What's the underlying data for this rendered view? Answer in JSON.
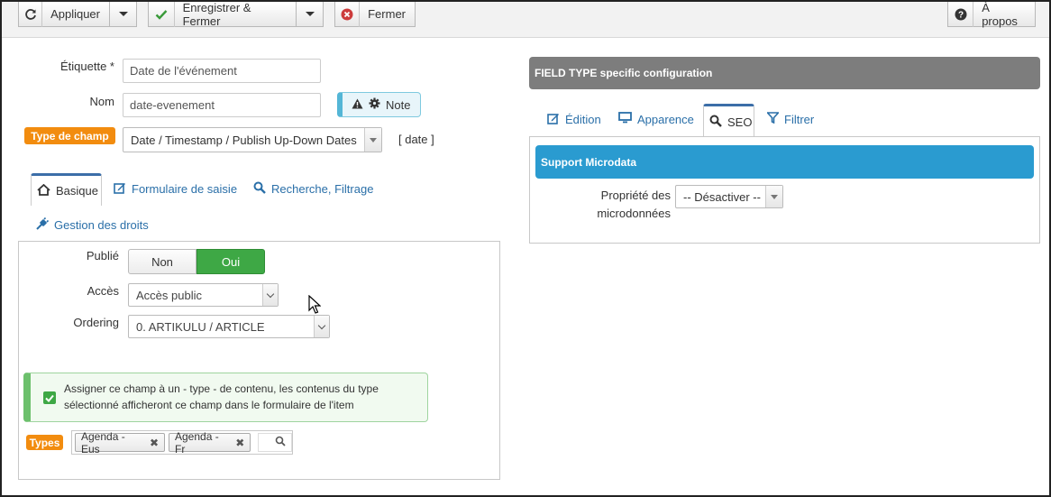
{
  "toolbar": {
    "apply_label": "Appliquer",
    "save_close_label": "Enregistrer & Fermer",
    "close_label": "Fermer",
    "about_label": "À propos"
  },
  "form": {
    "label_label": "Étiquette *",
    "label_value": "Date de l'événement",
    "name_label": "Nom",
    "name_value": "date-evenement",
    "note_label": "Note",
    "field_type_label": "Type de champ",
    "field_type_value": "Date / Timestamp / Publish Up-Down Dates",
    "field_type_code": "[ date ]"
  },
  "left_tabs": {
    "basic": "Basique",
    "entry_form": "Formulaire de saisie",
    "search_filter": "Recherche, Filtrage",
    "rights": "Gestion des droits"
  },
  "basic": {
    "published_label": "Publié",
    "toggle_no": "Non",
    "toggle_yes": "Oui",
    "access_label": "Accès",
    "access_value": "Accès public",
    "ordering_label": "Ordering",
    "ordering_value": "0. ARTIKULU / ARTICLE",
    "assign_text": "Assigner ce champ à un - type - de contenu, les contenus du type sélectionné afficheront ce champ dans le formulaire de l'item",
    "types_label": "Types",
    "types": [
      "Agenda - Eus",
      "Agenda - Fr"
    ]
  },
  "right": {
    "header": "FIELD TYPE specific configuration",
    "tabs": {
      "edition": "Édition",
      "appearance": "Apparence",
      "seo": "SEO",
      "filter": "Filtrer"
    },
    "microdata_header": "Support Microdata",
    "microdata_label_line1": "Propriété des",
    "microdata_label_line2": "microdonnées",
    "microdata_value": "-- Désactiver --"
  },
  "colors": {
    "accent_blue": "#2a9bd0",
    "success_green": "#3ea845",
    "badge_orange": "#f28c0f",
    "header_gray": "#7d7d7d",
    "link_blue": "#2a6fa8"
  }
}
